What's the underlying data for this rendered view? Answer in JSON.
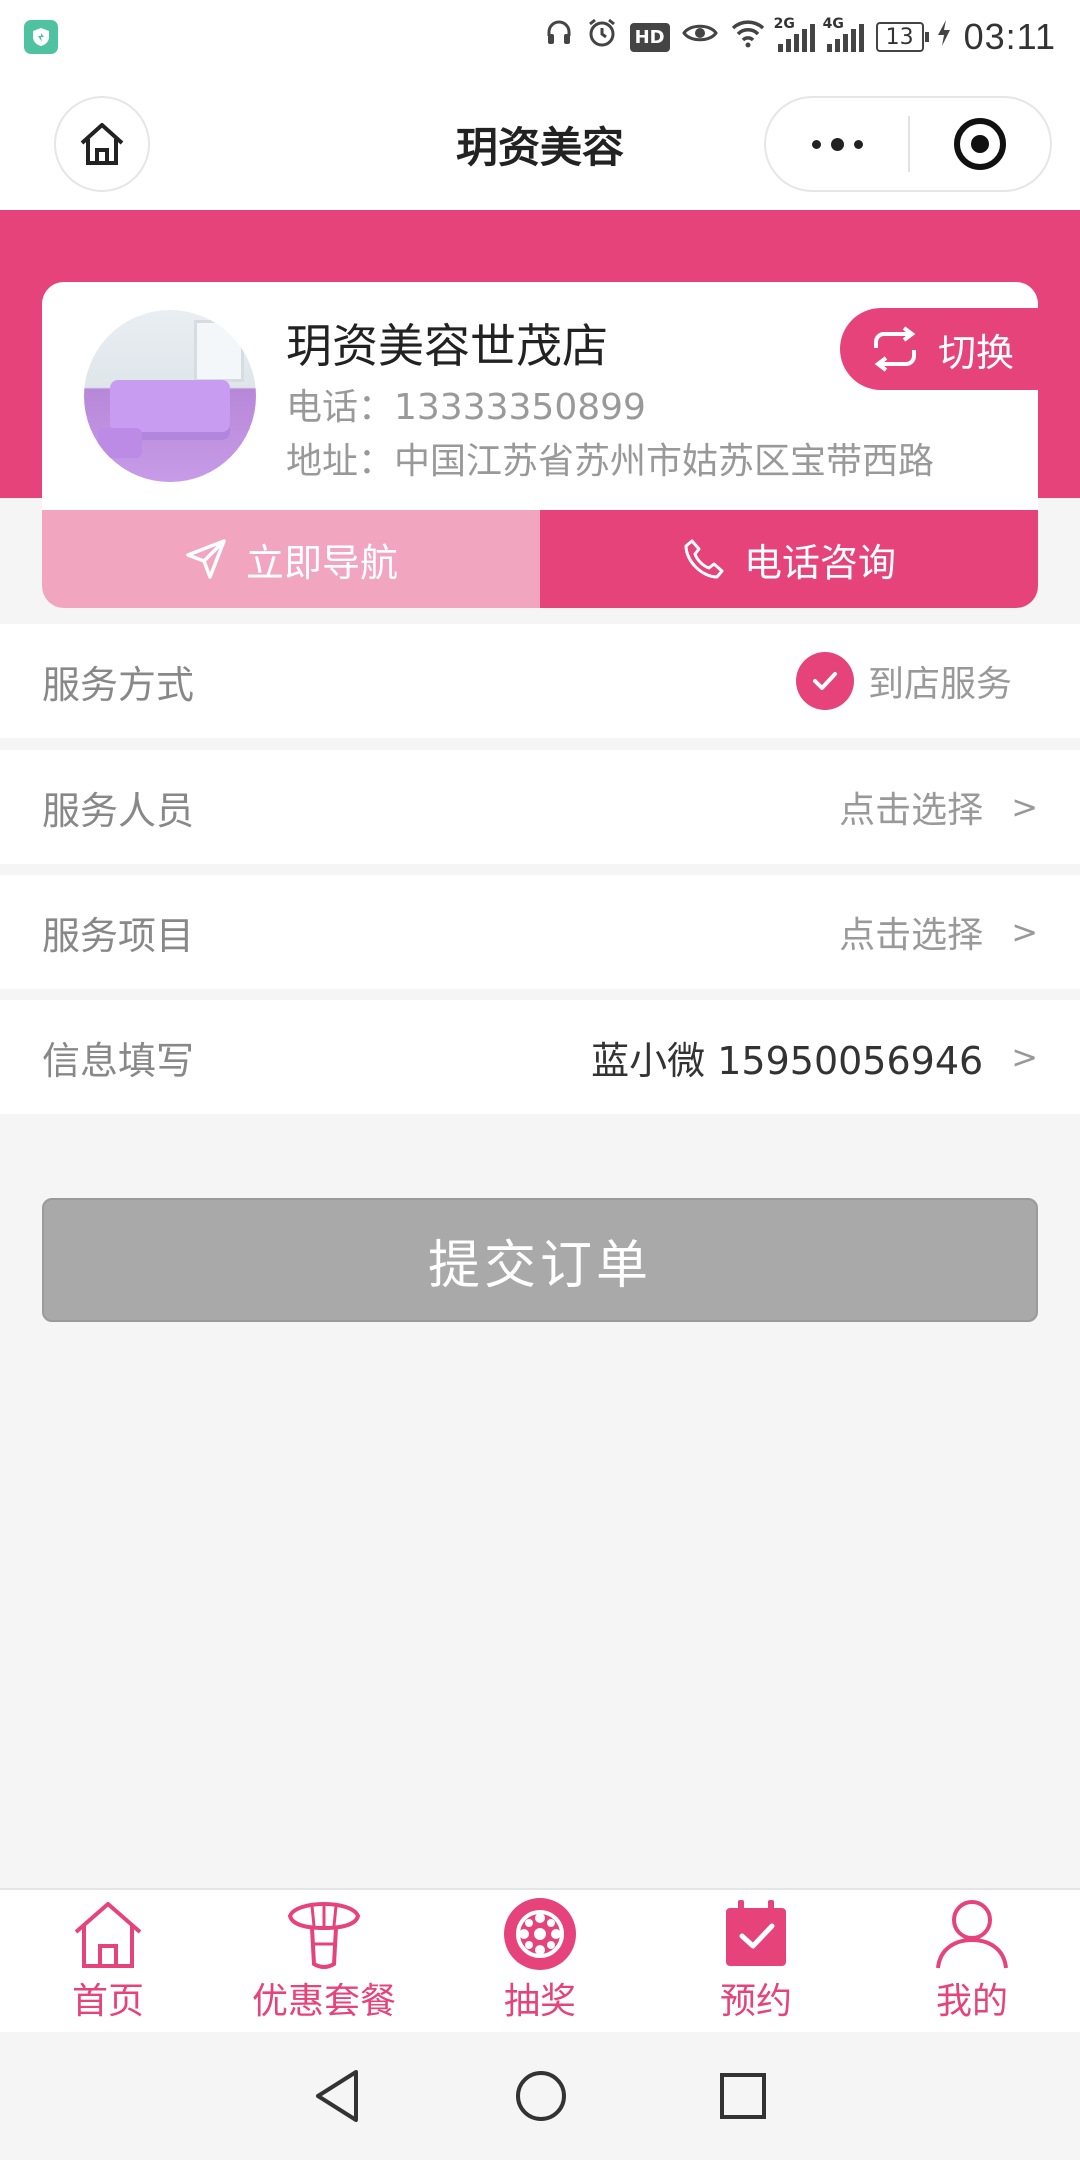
{
  "status_bar": {
    "signal1_label": "2G",
    "signal2_label": "4G",
    "battery": "13",
    "time": "03:11"
  },
  "nav": {
    "title": "玥资美容"
  },
  "store": {
    "name": "玥资美容世茂店",
    "phone": "电话：13333350899",
    "address": "地址：中国江苏省苏州市姑苏区宝带西路",
    "switch_label": "切换",
    "navigate_label": "立即导航",
    "call_label": "电话咨询"
  },
  "form": {
    "service_mode": {
      "label": "服务方式",
      "value": "到店服务"
    },
    "staff": {
      "label": "服务人员",
      "value": "点击选择",
      "arrow": ">"
    },
    "project": {
      "label": "服务项目",
      "value": "点击选择",
      "arrow": ">"
    },
    "info": {
      "label": "信息填写",
      "value": "蓝小微 15950056946",
      "arrow": ">"
    }
  },
  "submit_label": "提交订单",
  "tabbar": {
    "items": [
      {
        "label": "首页",
        "icon": "home-icon"
      },
      {
        "label": "优惠套餐",
        "icon": "package-icon"
      },
      {
        "label": "抽奖",
        "icon": "lottery-wheel-icon"
      },
      {
        "label": "预约",
        "icon": "calendar-check-icon"
      },
      {
        "label": "我的",
        "icon": "user-icon"
      }
    ]
  },
  "colors": {
    "accent": "#e6437a",
    "accent_light": "#f2a5be",
    "submit_disabled": "#a9a9a9"
  }
}
